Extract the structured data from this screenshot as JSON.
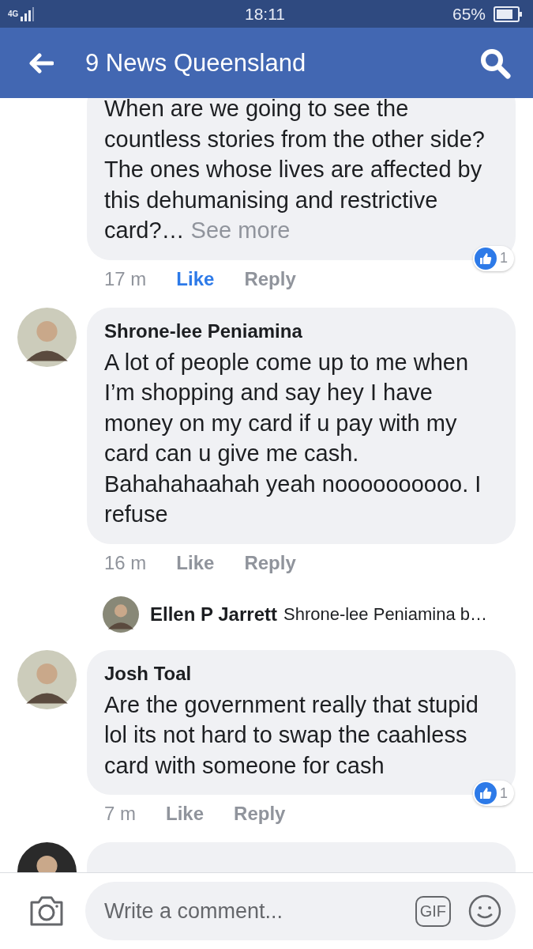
{
  "status_bar": {
    "network": "4G",
    "time": "18:11",
    "battery": "65%"
  },
  "header": {
    "title": "9 News Queensland"
  },
  "comments": [
    {
      "kind": "comment",
      "text": "When are we going to see the countless stories from the other side? The ones whose lives are affected by this dehumanising and restrictive card?…",
      "see_more": "See more",
      "time": "17 m",
      "like": "Like",
      "liked": true,
      "reply": "Reply",
      "reactions": "1"
    },
    {
      "kind": "comment",
      "name": "Shrone-lee Peniamina",
      "text": "A lot of people come up to me when I’m shopping and say hey I have money on my card if u pay with my card can u give me cash. Bahahahaahah yeah noooooooooo. I refuse",
      "time": "16 m",
      "like": "Like",
      "liked": false,
      "reply": "Reply"
    },
    {
      "kind": "reply_preview",
      "name": "Ellen P Jarrett",
      "text": "Shrone-lee Peniamina b…"
    },
    {
      "kind": "comment",
      "name": "Josh Toal",
      "text": "Are the government really that stupid lol its not hard to swap the caahless card with someone for cash",
      "time": "7 m",
      "like": "Like",
      "liked": false,
      "reply": "Reply",
      "reactions": "1"
    },
    {
      "kind": "partial"
    }
  ],
  "composer": {
    "placeholder": "Write a comment...",
    "gif": "GIF"
  }
}
